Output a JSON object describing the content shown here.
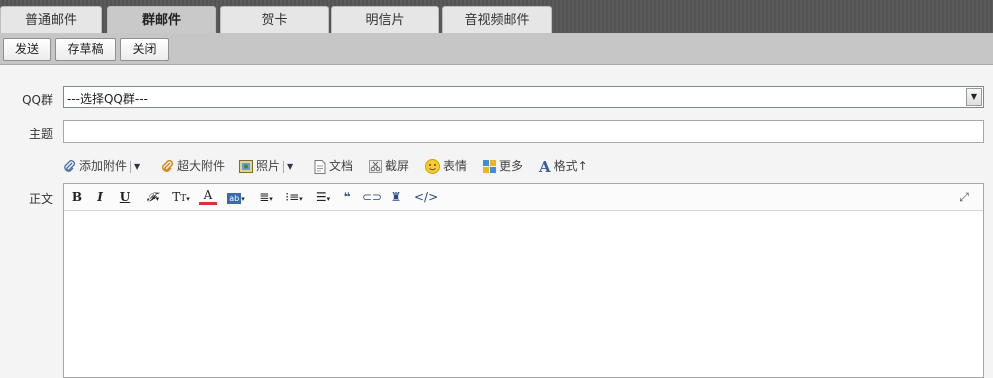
{
  "tabs": [
    {
      "label": "普通邮件",
      "active": false
    },
    {
      "label": "群邮件",
      "active": true
    },
    {
      "label": "贺卡",
      "active": false
    },
    {
      "label": "明信片",
      "active": false
    },
    {
      "label": "音视频邮件",
      "active": false
    }
  ],
  "toolbar": {
    "send": "发送",
    "save_draft": "存草稿",
    "close": "关闭"
  },
  "form": {
    "group_label": "QQ群",
    "group_select_value": "---选择QQ群---",
    "subject_label": "主题",
    "subject_value": "",
    "body_label": "正文"
  },
  "attachments": {
    "add_attachment": "添加附件",
    "large_attachment": "超大附件",
    "photo": "照片",
    "document": "文档",
    "screenshot": "截屏",
    "emoji": "表情",
    "more": "更多",
    "format": "格式↑"
  },
  "editor_tools": [
    "bold-icon",
    "italic-icon",
    "underline-icon",
    "font-icon",
    "font-size-icon",
    "font-color-icon",
    "background-color-icon",
    "align-icon",
    "ordered-list-icon",
    "unordered-list-icon",
    "quote-icon",
    "link-icon",
    "stamp-icon",
    "code-icon",
    "fullscreen-icon"
  ]
}
